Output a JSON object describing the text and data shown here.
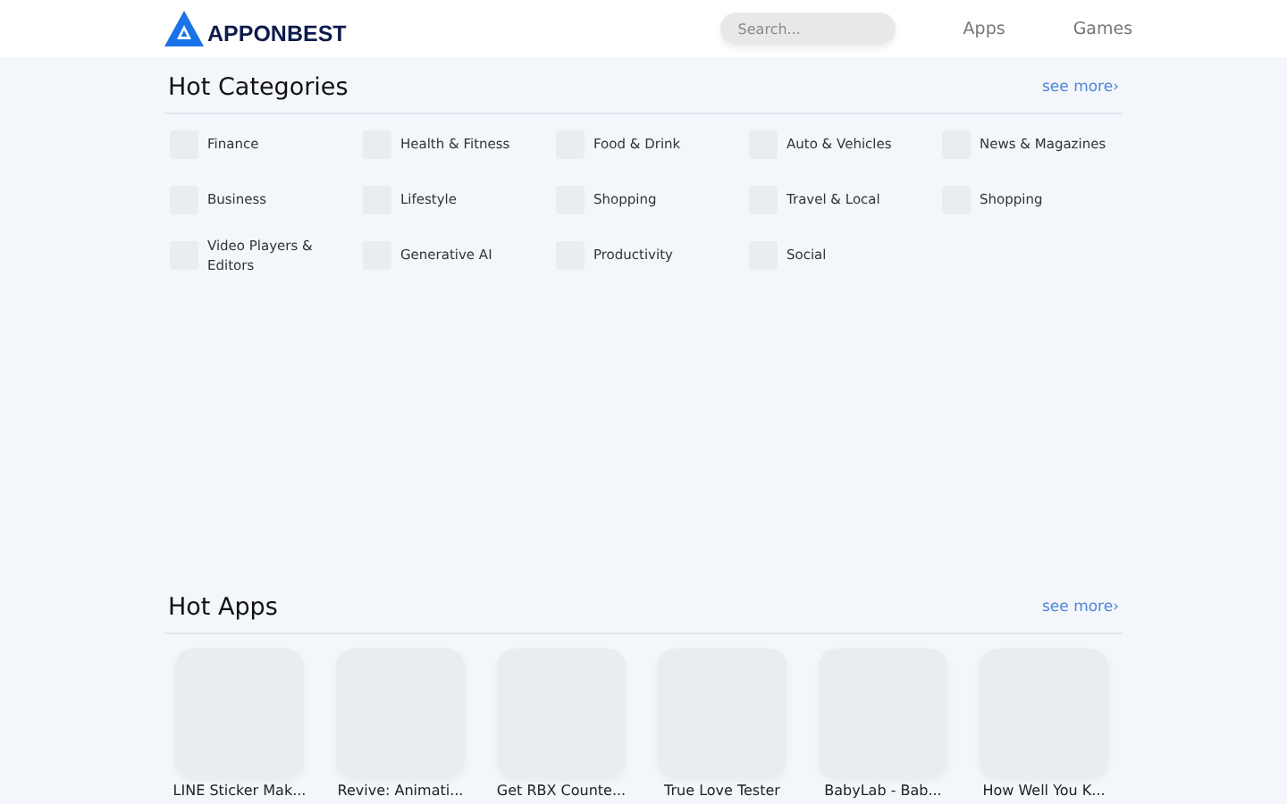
{
  "header": {
    "logo": "APPONBEST",
    "search": {
      "placeholder": "Search..."
    },
    "nav": [
      "Apps",
      "Games"
    ]
  },
  "hot_categories": {
    "title": "Hot Categories",
    "see_more": "see more›",
    "items": [
      {
        "label": "Finance"
      },
      {
        "label": "Health & Fitness"
      },
      {
        "label": "Food & Drink"
      },
      {
        "label": "Auto & Vehicles"
      },
      {
        "label": "News & Magazines"
      },
      {
        "label": "Business"
      },
      {
        "label": "Lifestyle"
      },
      {
        "label": "Shopping"
      },
      {
        "label": "Travel & Local"
      },
      {
        "label": "Shopping"
      },
      {
        "label": "Video Players & Editors"
      },
      {
        "label": "Generative AI"
      },
      {
        "label": "Productivity"
      },
      {
        "label": "Social"
      }
    ]
  },
  "hot_apps": {
    "title": "Hot Apps",
    "see_more": "see more›",
    "items": [
      {
        "name": "LINE Sticker Mak..."
      },
      {
        "name": "Revive: Animati..."
      },
      {
        "name": "Get RBX Counte..."
      },
      {
        "name": "True Love Tester"
      },
      {
        "name": "BabyLab - Bab..."
      },
      {
        "name": "How Well You K..."
      }
    ]
  }
}
